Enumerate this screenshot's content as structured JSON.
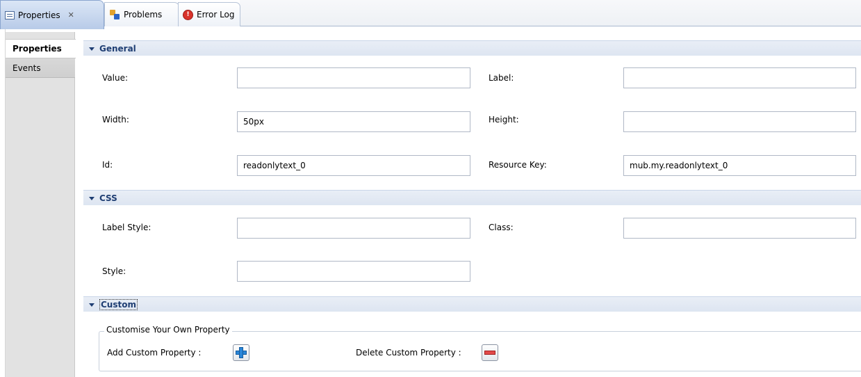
{
  "tabs": [
    {
      "label": "Properties",
      "icon": "properties-icon",
      "active": true
    },
    {
      "label": "Problems",
      "icon": "problems-icon",
      "active": false
    },
    {
      "label": "Error Log",
      "icon": "error-log-icon",
      "active": false
    }
  ],
  "sidebar": {
    "items": [
      {
        "label": "Properties",
        "selected": true
      },
      {
        "label": "Events",
        "selected": false
      }
    ]
  },
  "sections": {
    "general": {
      "title": "General",
      "fields": {
        "value": {
          "label": "Value:",
          "value": ""
        },
        "label": {
          "label": "Label:",
          "value": ""
        },
        "width": {
          "label": "Width:",
          "value": "50px"
        },
        "height": {
          "label": "Height:",
          "value": ""
        },
        "id": {
          "label": "Id:",
          "value": "readonlytext_0"
        },
        "resource_key": {
          "label": "Resource Key:",
          "value": "mub.my.readonlytext_0"
        }
      }
    },
    "css": {
      "title": "CSS",
      "fields": {
        "label_style": {
          "label": "Label Style:",
          "value": ""
        },
        "class": {
          "label": "Class:",
          "value": ""
        },
        "style": {
          "label": "Style:",
          "value": ""
        }
      }
    },
    "custom": {
      "title": "Custom",
      "group_title": "Customise Your Own Property",
      "add_label": "Add Custom Property :",
      "delete_label": "Delete Custom Property :"
    }
  },
  "colors": {
    "section_header_text": "#1f3e73",
    "add_icon": "#2a86d8",
    "delete_icon": "#e24a4a"
  }
}
